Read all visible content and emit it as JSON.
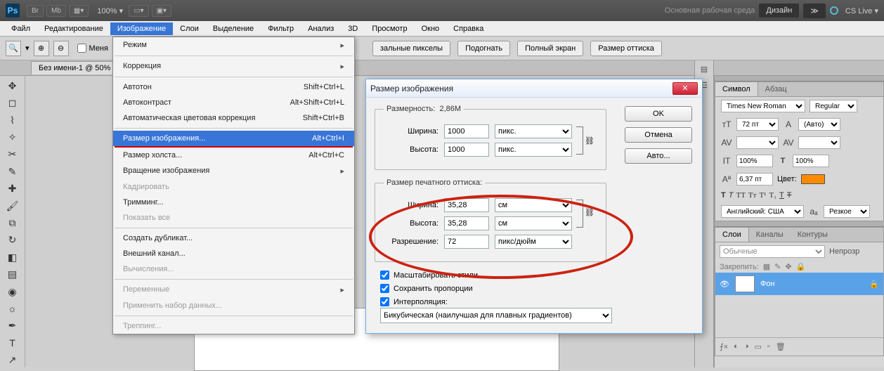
{
  "appbar": {
    "logo": "Ps",
    "btn_br": "Br",
    "btn_mb": "Mb",
    "zoom": "100%",
    "workspace_label": "Основная рабочая среда",
    "workspace_btn": "Дизайн",
    "cs_live": "CS Live"
  },
  "menus": [
    "Файл",
    "Редактирование",
    "Изображение",
    "Слои",
    "Выделение",
    "Фильтр",
    "Анализ",
    "3D",
    "Просмотр",
    "Окно",
    "Справка"
  ],
  "optbar": {
    "chk_label": "Меня",
    "pill1": "зальные пикселы",
    "pill2": "Подогнать",
    "pill3": "Полный экран",
    "pill4": "Размер оттиска"
  },
  "doc_tab": "Без имени-1 @ 50%",
  "dropdown": {
    "mode": "Режим",
    "correction": "Коррекция",
    "autotone": "Автотон",
    "autotone_kb": "Shift+Ctrl+L",
    "autocontrast": "Автоконтраст",
    "autocontrast_kb": "Alt+Shift+Ctrl+L",
    "autocolor": "Автоматическая цветовая коррекция",
    "autocolor_kb": "Shift+Ctrl+B",
    "img_size": "Размер изображения...",
    "img_size_kb": "Alt+Ctrl+I",
    "canvas_size": "Размер холста...",
    "canvas_size_kb": "Alt+Ctrl+C",
    "rotation": "Вращение изображения",
    "crop": "Кадрировать",
    "trim": "Тримминг...",
    "reveal": "Показать все",
    "duplicate": "Создать дубликат...",
    "ext_channel": "Внешний канал...",
    "calc": "Вычисления...",
    "vars": "Переменные",
    "apply_ds": "Применить набор данных...",
    "trap": "Треппинг..."
  },
  "dialog": {
    "title": "Размер изображения",
    "ok": "OK",
    "cancel": "Отмена",
    "auto": "Авто...",
    "dim_legend": "Размерность:",
    "dim_val": "2,86M",
    "width_l": "Ширина:",
    "height_l": "Высота:",
    "res_l": "Разрешение:",
    "width_px": "1000",
    "height_px": "1000",
    "unit_px": "пикс.",
    "print_legend": "Размер печатного оттиска:",
    "width_cm": "35,28",
    "height_cm": "35,28",
    "unit_cm": "см",
    "res_val": "72",
    "unit_res": "пикс/дюйм",
    "scale_styles": "Масштабировать стили",
    "constrain": "Сохранить пропорции",
    "interp_l": "Интерполяция:",
    "interp_val": "Бикубическая (наилучшая для плавных градиентов)"
  },
  "char": {
    "tab1": "Символ",
    "tab2": "Абзац",
    "font": "Times New Roman",
    "style": "Regular",
    "size": "72 пт",
    "leading": "(Авто)",
    "scale_v": "100%",
    "scale_h": "100%",
    "baseline": "6,37 пт",
    "color_l": "Цвет:",
    "lang": "Английский: США",
    "aa": "Резкое"
  },
  "layers": {
    "tab1": "Слои",
    "tab2": "Каналы",
    "tab3": "Контуры",
    "mode": "Обычные",
    "opacity_l": "Непрозр",
    "lock_l": "Закрепить:",
    "layer_name": "Фон"
  }
}
